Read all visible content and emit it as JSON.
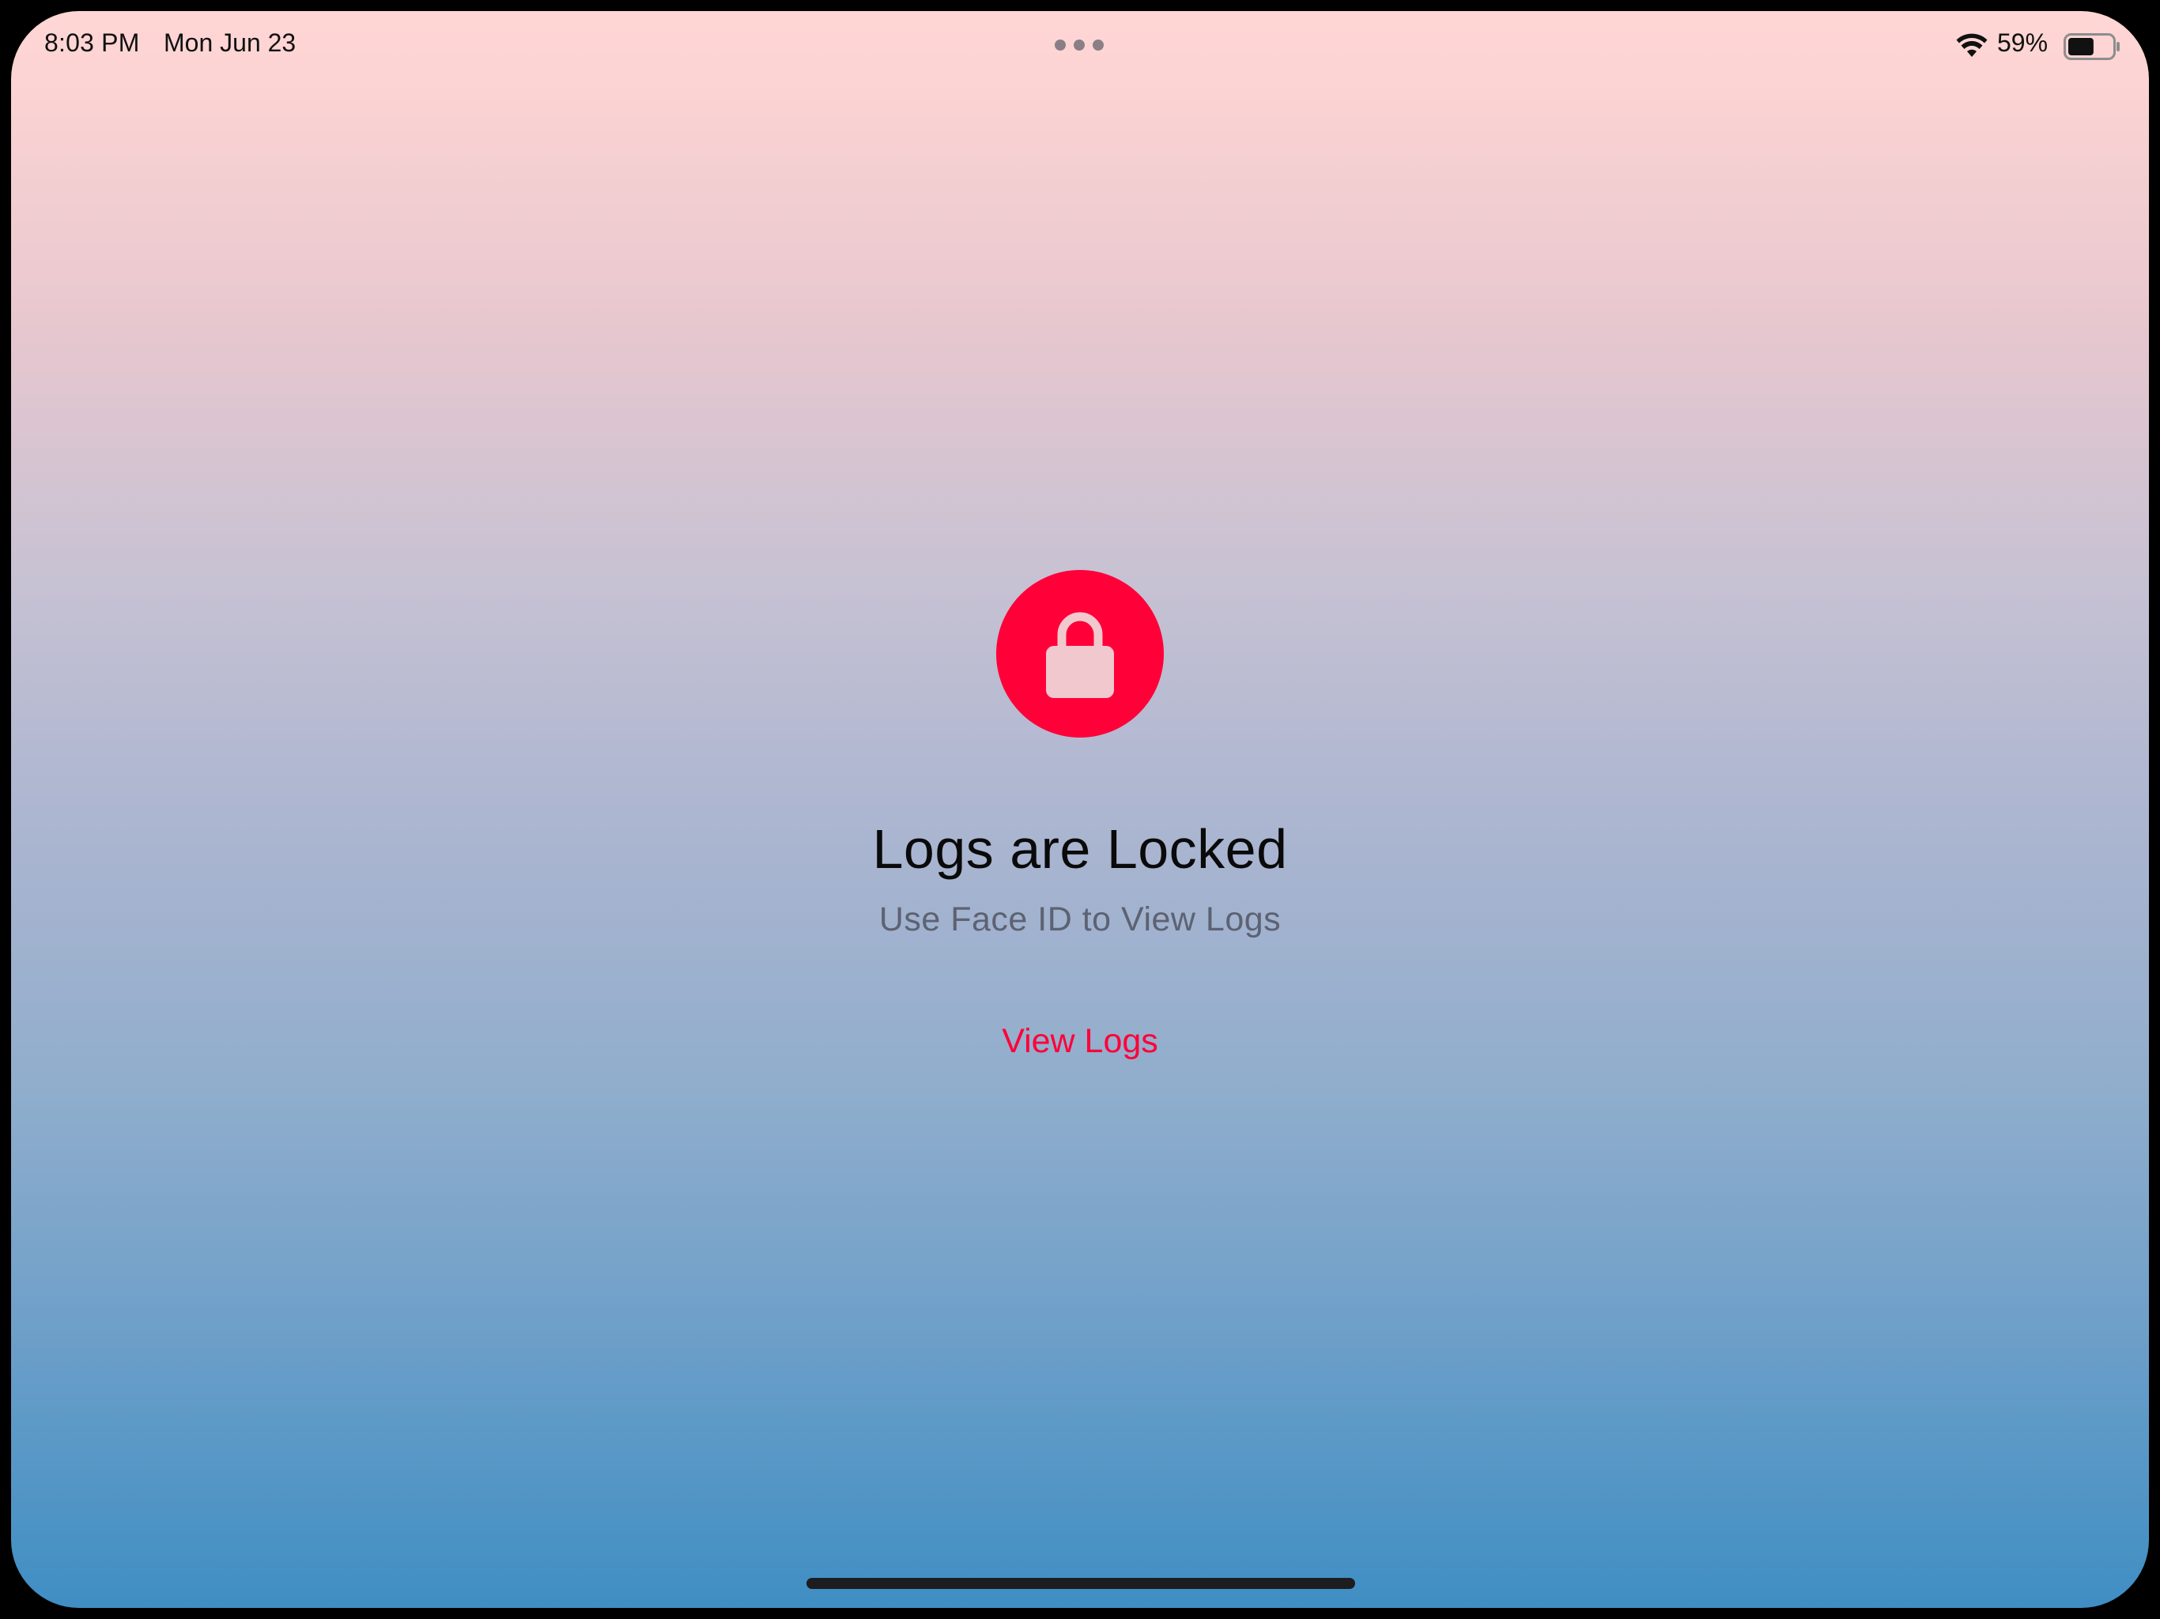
{
  "status_bar": {
    "time": "8:03 PM",
    "date": "Mon Jun 23",
    "battery_percent": "59%",
    "battery_level": 0.59,
    "icons": [
      "wifi-icon",
      "battery-icon",
      "multitask-dots-icon"
    ]
  },
  "lock_screen": {
    "icon": "lock-icon",
    "title": "Logs are Locked",
    "subtitle": "Use Face ID to View Logs",
    "button_label": "View Logs"
  },
  "colors": {
    "accent": "#ff0039",
    "title": "#0a0a0a",
    "subtitle": "#5d6272",
    "gradient_top": "#ffd6d4",
    "gradient_bottom": "#3f8ec3"
  }
}
